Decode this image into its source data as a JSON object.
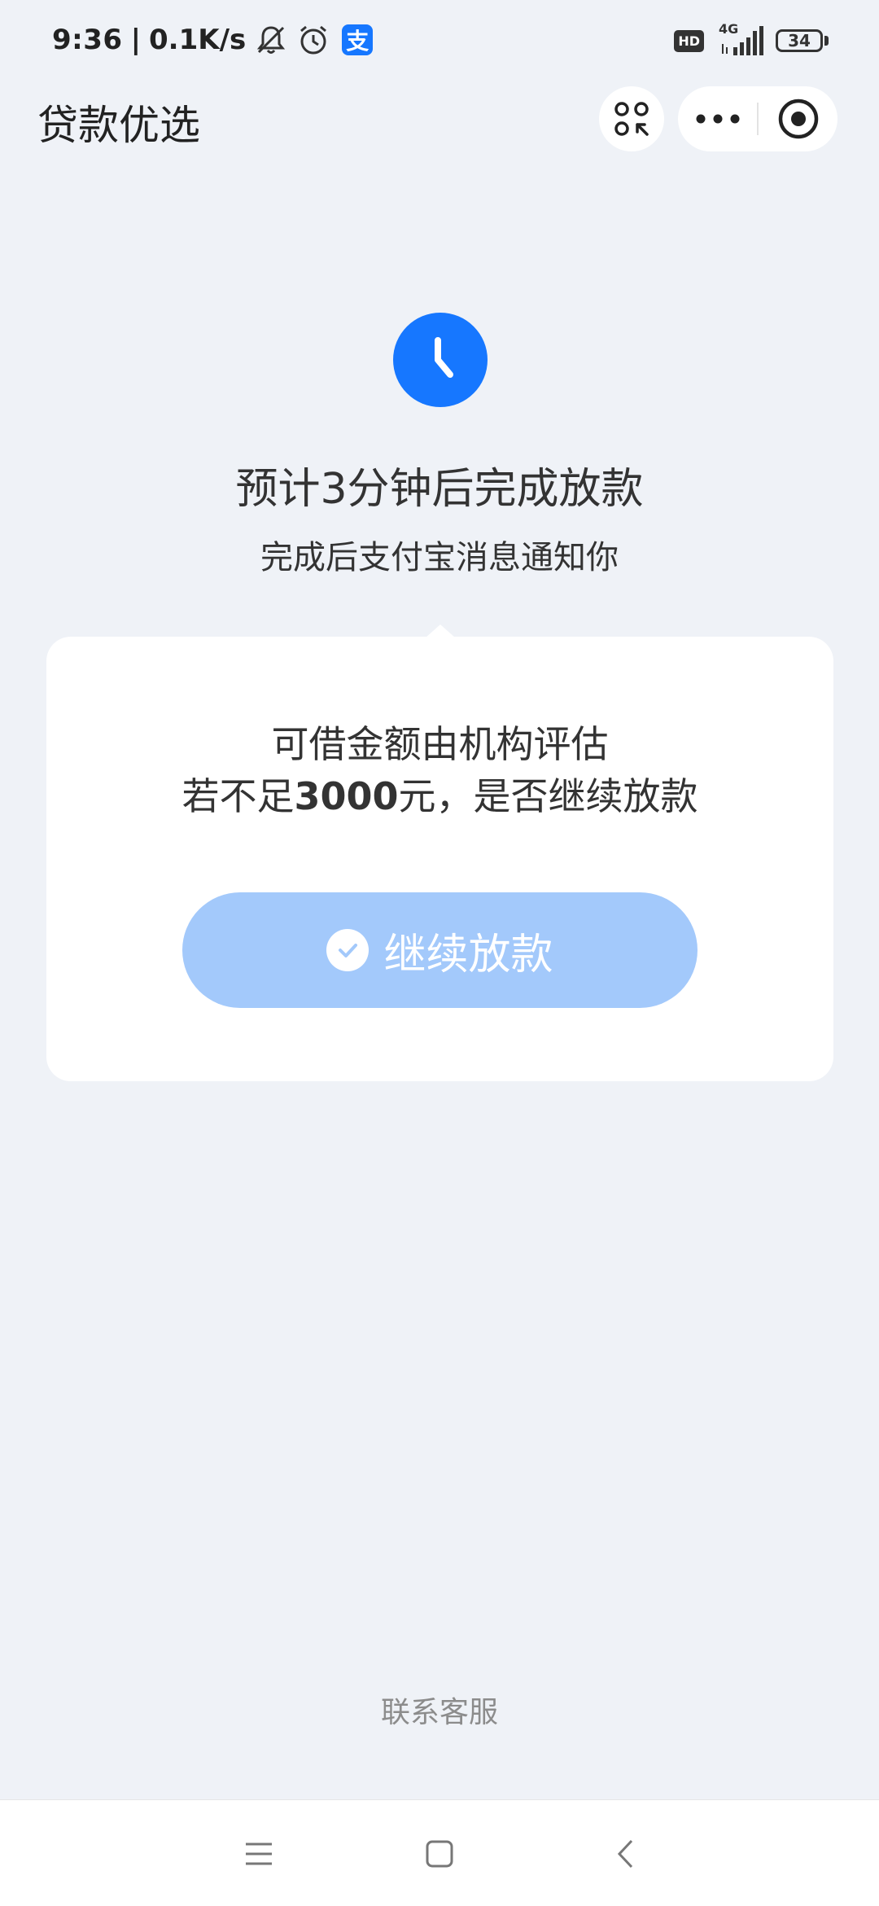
{
  "status_bar": {
    "time": "9:36",
    "separator": "|",
    "net_speed": "0.1K/s",
    "alipay_icon_text": "支",
    "hd_label": "HD",
    "network_label": "4G",
    "battery": "34",
    "icons": [
      "mute-bell-icon",
      "alarm-clock-icon",
      "alipay-icon",
      "signal-icon",
      "battery-icon"
    ]
  },
  "header": {
    "title": "贷款优选",
    "icons": [
      "apps-grid-icon",
      "more-dots-icon",
      "close-record-icon"
    ]
  },
  "status_section": {
    "icon": "clock-icon",
    "headline": "预计3分钟后完成放款",
    "subline": "完成后支付宝消息通知你"
  },
  "card": {
    "line1": "可借金额由机构评估",
    "line2_prefix": "若不足",
    "line2_amount": "3000",
    "line2_suffix": "元，是否继续放款",
    "button_label": "继续放款",
    "button_icon": "check-circle-icon"
  },
  "footer": {
    "service_link": "联系客服"
  },
  "system_nav": {
    "icons": [
      "menu-icon",
      "home-square-icon",
      "back-chevron-icon"
    ]
  },
  "colors": {
    "background": "#eff2f7",
    "accent": "#1677ff",
    "button_disabled": "#a3c9fb",
    "card": "#ffffff",
    "muted_text": "#8c8c8c"
  }
}
